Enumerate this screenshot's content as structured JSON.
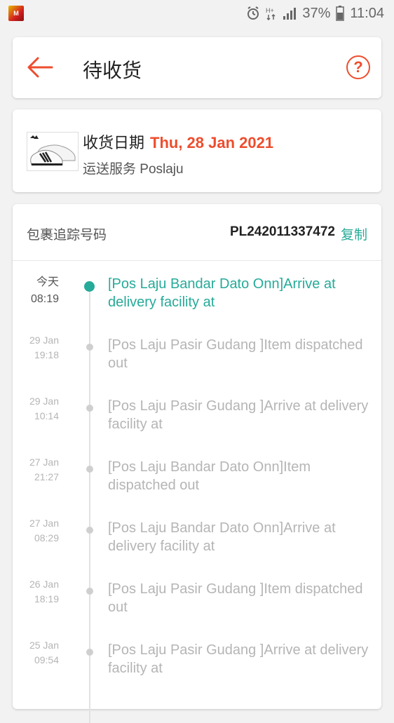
{
  "status_bar": {
    "battery": "37%",
    "time": "11:04",
    "app_icon_text": "M"
  },
  "header": {
    "title": "待收货"
  },
  "delivery": {
    "label": "收货日期",
    "date": "Thu, 28 Jan 2021",
    "service": "运送服务 Poslaju"
  },
  "tracking": {
    "label": "包裹追踪号码",
    "number": "PL242011337472",
    "copy_label": "复制",
    "events": [
      {
        "day": "今天",
        "time": "08:19",
        "text": "[Pos Laju Bandar Dato Onn]Arrive at delivery facility at"
      },
      {
        "day": "29 Jan",
        "time": "19:18",
        "text": "[Pos Laju Pasir Gudang ]Item dispatched out"
      },
      {
        "day": "29 Jan",
        "time": "10:14",
        "text": "[Pos Laju Pasir Gudang ]Arrive at delivery facility at"
      },
      {
        "day": "27 Jan",
        "time": "21:27",
        "text": "[Pos Laju Bandar Dato Onn]Item dispatched out"
      },
      {
        "day": "27 Jan",
        "time": "08:29",
        "text": "[Pos Laju Bandar Dato Onn]Arrive at delivery facility at"
      },
      {
        "day": "26 Jan",
        "time": "18:19",
        "text": "[Pos Laju Pasir Gudang ]Item dispatched out"
      },
      {
        "day": "25 Jan",
        "time": "09:54",
        "text": "[Pos Laju Pasir Gudang ]Arrive at delivery facility at"
      }
    ]
  },
  "colors": {
    "accent": "#ee4d2d",
    "teal": "#26aa99",
    "muted": "#b5b5b5"
  },
  "icons": [
    "back-arrow-icon",
    "help-icon",
    "alarm-icon",
    "network-icon",
    "signal-icon",
    "battery-icon"
  ]
}
